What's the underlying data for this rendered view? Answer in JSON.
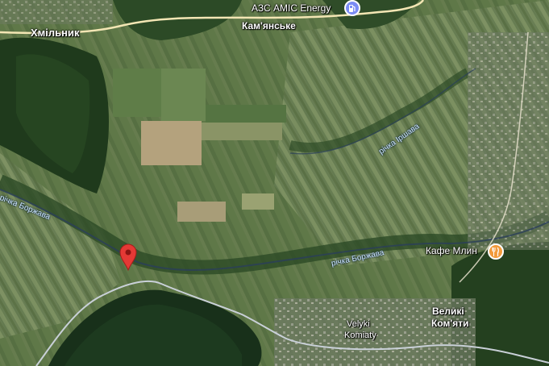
{
  "places": {
    "khmilnyk": "Хмільник",
    "kamianske": "Кам'янське",
    "velyki_komiaty_uk_line1": "Великі",
    "velyki_komiaty_uk_line2": "Ком'яти",
    "velyki_komiaty_en_line1": "Velyki",
    "velyki_komiaty_en_line2": "Komiaty"
  },
  "rivers": {
    "borzhava_west": "річка Боржава",
    "borzhava_east": "річка Боржава",
    "irshava": "річка Іршава"
  },
  "pois": {
    "gas_station": {
      "label": "АЗС AMIC Energy",
      "icon": "gas-station-icon",
      "color": "#7b8cf5"
    },
    "cafe": {
      "label": "Кафе Млин",
      "icon": "fork-knife-icon",
      "color": "#f29a3a"
    }
  },
  "marker": {
    "icon": "location-pin-icon",
    "color": "#e53935"
  },
  "colors": {
    "road": "#f3e6b4",
    "border": "#c9d0d8"
  }
}
